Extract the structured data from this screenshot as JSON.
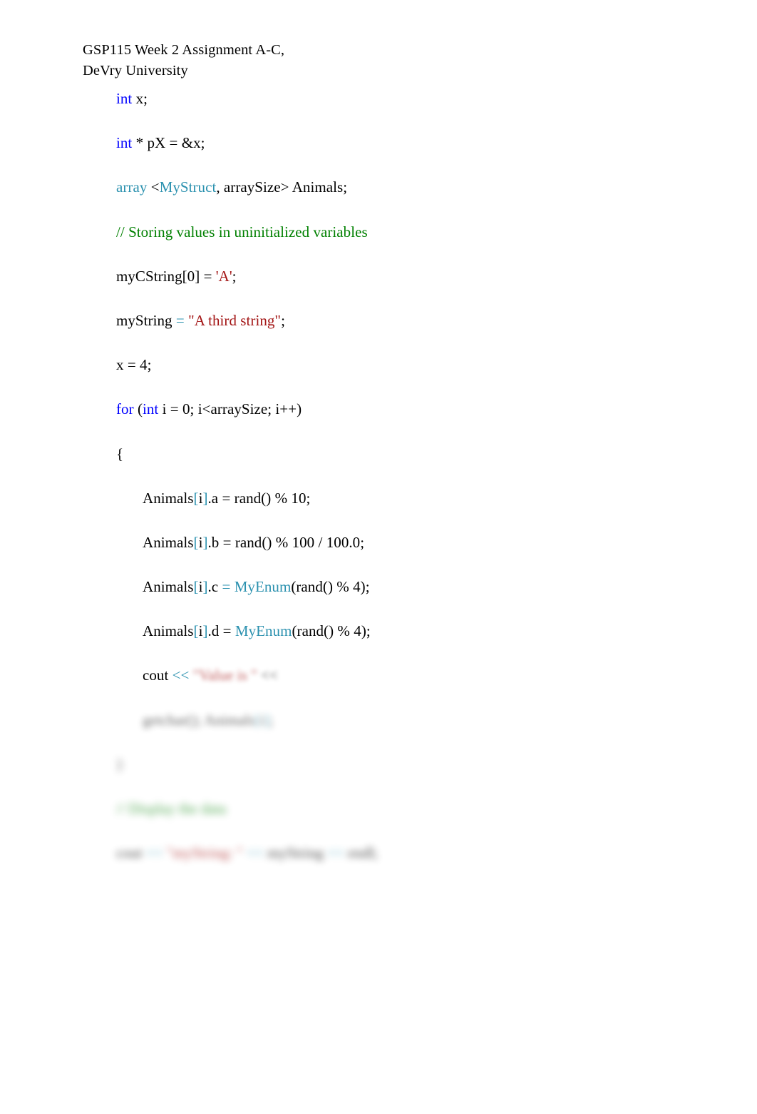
{
  "document": {
    "header": {
      "line1": "GSP115 Week 2 Assignment A-C,",
      "line2": "DeVry University"
    },
    "colors": {
      "keyword": "#0000FF",
      "type": "#2B91AF",
      "comment": "#008000",
      "string": "#A31515",
      "operator": "#2B91AF",
      "plain": "#000000",
      "background": "#FFFFFF"
    },
    "code": {
      "line_01": {
        "kw": "int",
        "rest": " x;"
      },
      "line_02": {
        "kw": "int",
        "rest": " * pX = &x;"
      },
      "line_03": {
        "t1": "array",
        "p1": " <",
        "t2": "MyStruct",
        "p2": ", arraySize> Animals;"
      },
      "line_04": {
        "comment": "// Storing values in uninitialized variables"
      },
      "line_05": {
        "p1": "myCString[0] = ",
        "str": "'A'",
        "p2": ";"
      },
      "line_06": {
        "p1": "myString ",
        "op": "=",
        "p2": " ",
        "str": "\"A third string\"",
        "p3": ";"
      },
      "line_07": {
        "text": "x = 4;"
      },
      "line_08": {
        "kw1": "for",
        "p1": " (",
        "kw2": "int",
        "p2": " i = 0; i<arraySize; i++)"
      },
      "line_09": {
        "text": "{"
      },
      "line_10": {
        "p1": "Animals",
        "b1": "[",
        "p2": "i",
        "b2": "]",
        "p3": ".a = rand() % 10;"
      },
      "line_11": {
        "p1": "Animals",
        "b1": "[",
        "p2": "i",
        "b2": "]",
        "p3": ".b = rand() % 100 / 100.0;"
      },
      "line_12": {
        "p1": "Animals",
        "b1": "[",
        "p2": "i",
        "b2": "]",
        "p3": ".c ",
        "op": "=",
        "p4": " ",
        "t1": "MyEnum",
        "p5": "(rand() % 4);"
      },
      "line_13": {
        "p1": "Animals",
        "b1": "[",
        "p2": "i",
        "b2": "]",
        "p3": ".d = ",
        "t1": "MyEnum",
        "p4": "(rand() % 4);"
      },
      "line_14": {
        "p1": "cout ",
        "op": "<<",
        "p2": " ",
        "str": "\"Value is \"",
        "p3": " <<"
      },
      "line_15": {
        "p1": "getchar(); Animals",
        "b1": "[",
        "p2": "i",
        "b2": "]",
        "p3": ";"
      },
      "line_16": {
        "text": "}"
      },
      "line_17": {
        "comment": "// Display the data"
      },
      "line_18": {
        "p1": "cout ",
        "op1": "<<",
        "p2": " ",
        "str": "\"myString: \"",
        "p3": " ",
        "op2": "<<",
        "p4": " myString ",
        "op3": "<<",
        "p5": " endl;"
      }
    }
  }
}
